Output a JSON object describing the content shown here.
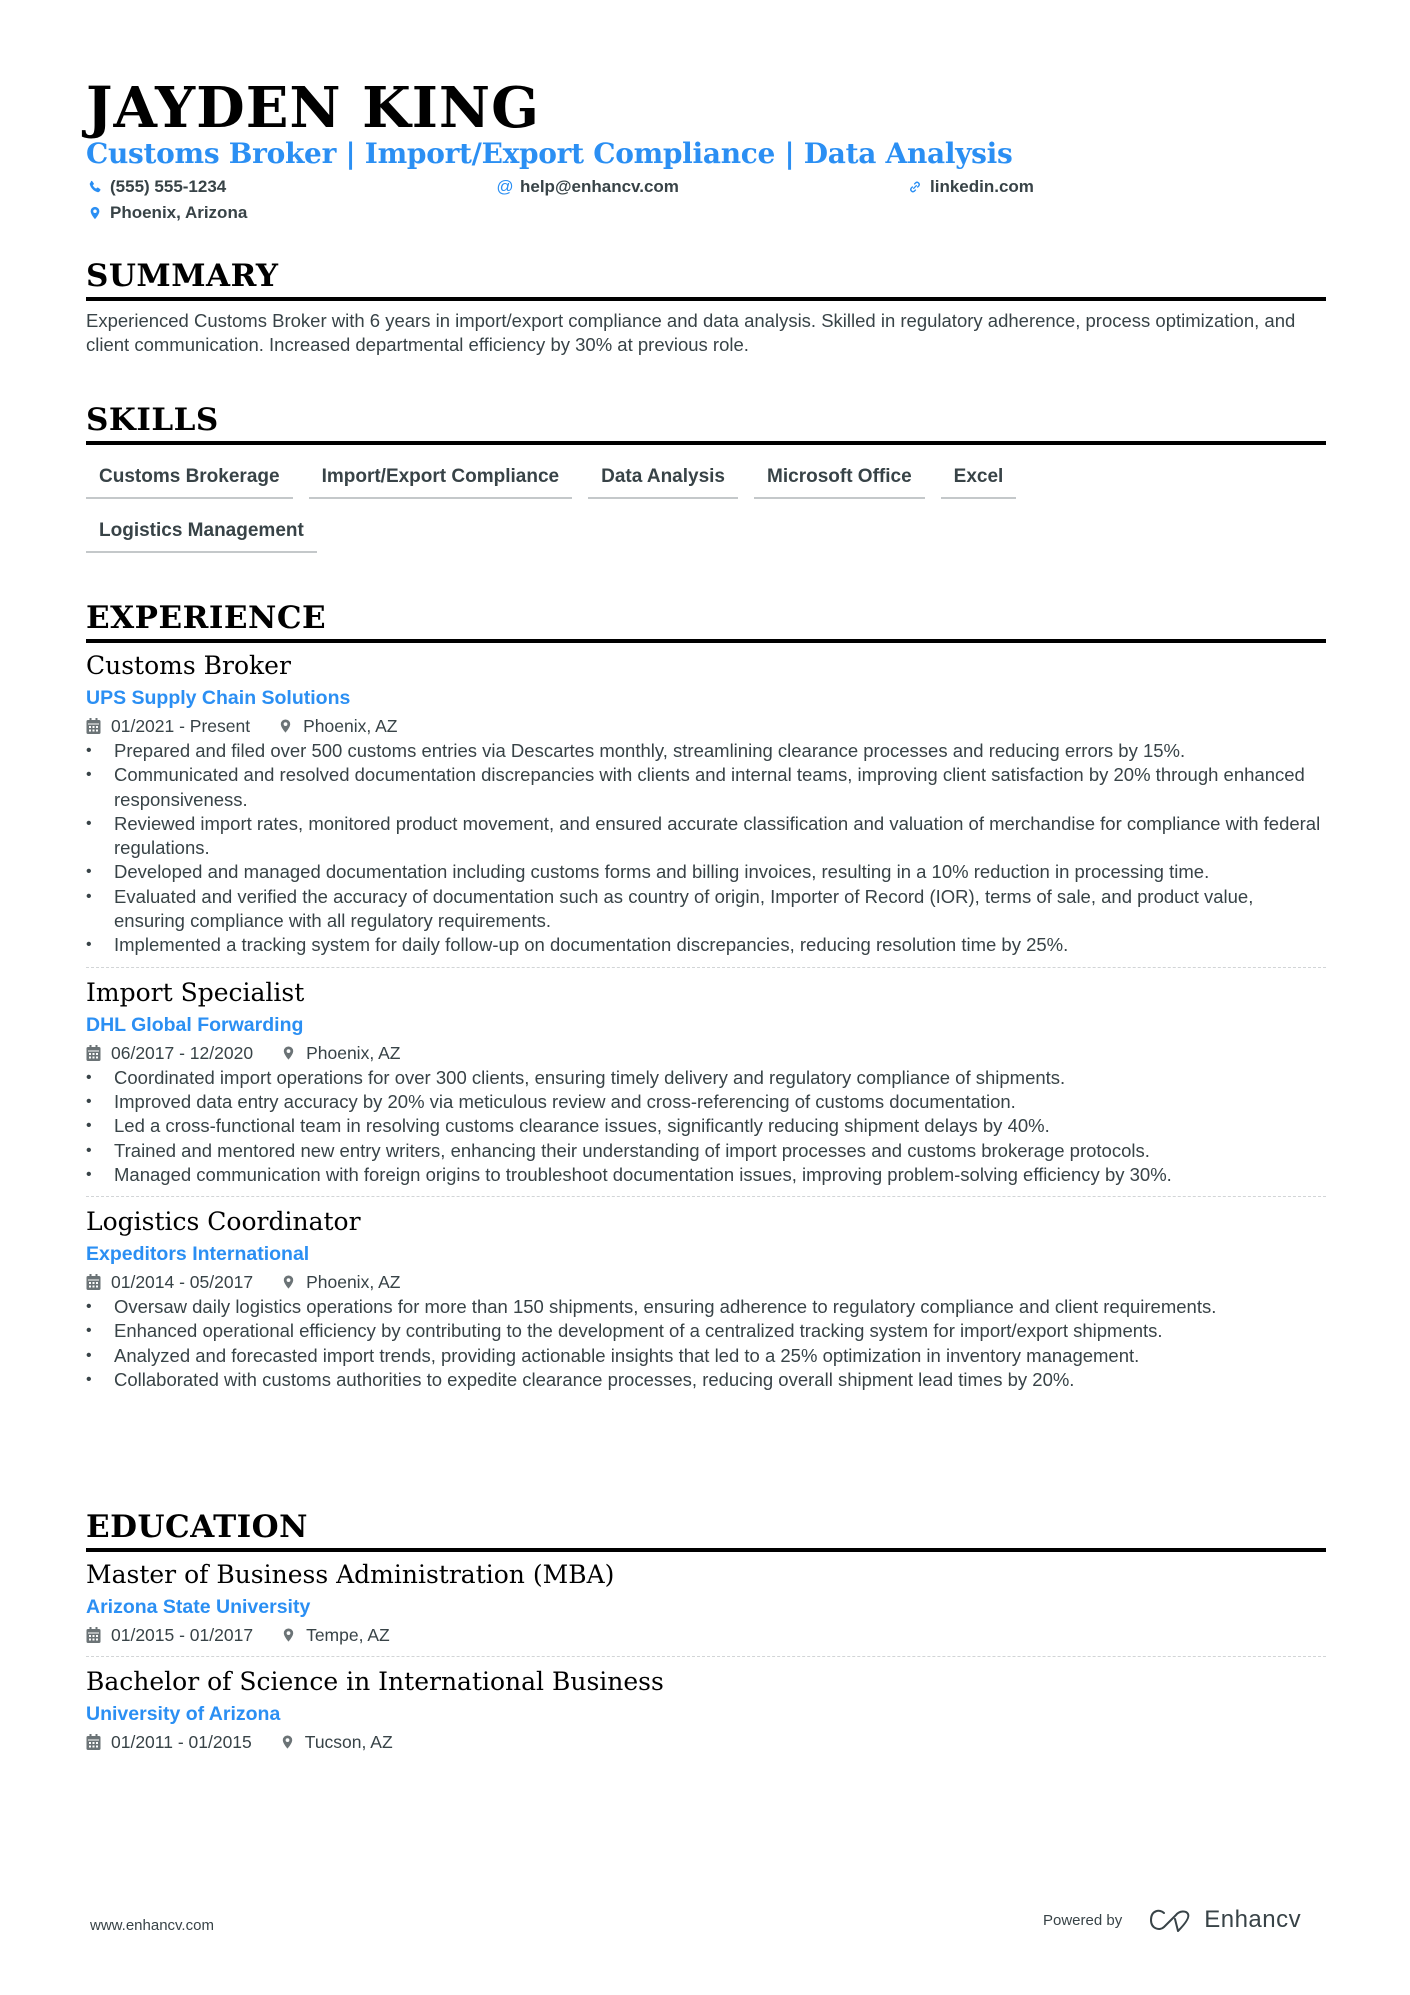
{
  "header": {
    "name": "JAYDEN KING",
    "title": "Customs Broker | Import/Export Compliance | Data Analysis",
    "contacts": {
      "phone": {
        "icon": "phone-icon",
        "value": "(555) 555-1234"
      },
      "email": {
        "icon": "at-icon",
        "value": "help@enhancv.com"
      },
      "linkedin": {
        "icon": "link-icon",
        "value": "linkedin.com"
      },
      "location": {
        "icon": "location-pin-icon",
        "value": "Phoenix, Arizona"
      }
    }
  },
  "summary": {
    "heading": "SUMMARY",
    "text": "Experienced Customs Broker with 6 years in import/export compliance and data analysis. Skilled in regulatory adherence, process optimization, and client communication. Increased departmental efficiency by 30% at previous role."
  },
  "skills": {
    "heading": "SKILLS",
    "items": [
      "Customs Brokerage",
      "Import/Export Compliance",
      "Data Analysis",
      "Microsoft Office",
      "Excel",
      "Logistics Management"
    ]
  },
  "experience": {
    "heading": "EXPERIENCE",
    "items": [
      {
        "title": "Customs Broker",
        "company": "UPS Supply Chain Solutions",
        "dates": "01/2021 - Present",
        "location": "Phoenix, AZ",
        "bullets": [
          "Prepared and filed over 500 customs entries via Descartes monthly, streamlining clearance processes and reducing errors by 15%.",
          "Communicated and resolved documentation discrepancies with clients and internal teams, improving client satisfaction by 20% through enhanced responsiveness.",
          "Reviewed import rates, monitored product movement, and ensured accurate classification and valuation of merchandise for compliance with federal regulations.",
          "Developed and managed documentation including customs forms and billing invoices, resulting in a 10% reduction in processing time.",
          "Evaluated and verified the accuracy of documentation such as country of origin, Importer of Record (IOR), terms of sale, and product value, ensuring compliance with all regulatory requirements.",
          "Implemented a tracking system for daily follow-up on documentation discrepancies, reducing resolution time by 25%."
        ]
      },
      {
        "title": "Import Specialist",
        "company": "DHL Global Forwarding",
        "dates": "06/2017 - 12/2020",
        "location": "Phoenix, AZ",
        "bullets": [
          "Coordinated import operations for over 300 clients, ensuring timely delivery and regulatory compliance of shipments.",
          "Improved data entry accuracy by 20% via meticulous review and cross-referencing of customs documentation.",
          "Led a cross-functional team in resolving customs clearance issues, significantly reducing shipment delays by 40%.",
          "Trained and mentored new entry writers, enhancing their understanding of import processes and customs brokerage protocols.",
          "Managed communication with foreign origins to troubleshoot documentation issues, improving problem-solving efficiency by 30%."
        ]
      },
      {
        "title": "Logistics Coordinator",
        "company": "Expeditors International",
        "dates": "01/2014 - 05/2017",
        "location": "Phoenix, AZ",
        "bullets": [
          "Oversaw daily logistics operations for more than 150 shipments, ensuring adherence to regulatory compliance and client requirements.",
          "Enhanced operational efficiency by contributing to the development of a centralized tracking system for import/export shipments.",
          "Analyzed and forecasted import trends, providing actionable insights that led to a 25% optimization in inventory management.",
          "Collaborated with customs authorities to expedite clearance processes, reducing overall shipment lead times by 20%."
        ]
      }
    ]
  },
  "education": {
    "heading": "EDUCATION",
    "items": [
      {
        "degree": "Master of Business Administration (MBA)",
        "school": "Arizona State University",
        "dates": "01/2015 - 01/2017",
        "location": "Tempe, AZ"
      },
      {
        "degree": "Bachelor of Science in International Business",
        "school": "University of Arizona",
        "dates": "01/2011 - 01/2015",
        "location": "Tucson, AZ"
      }
    ]
  },
  "footer": {
    "website": "www.enhancv.com",
    "powered_by": "Powered by",
    "brand": "Enhancv"
  },
  "colors": {
    "accent": "#2b8ff3",
    "heading": "#000000",
    "text": "#384347"
  }
}
